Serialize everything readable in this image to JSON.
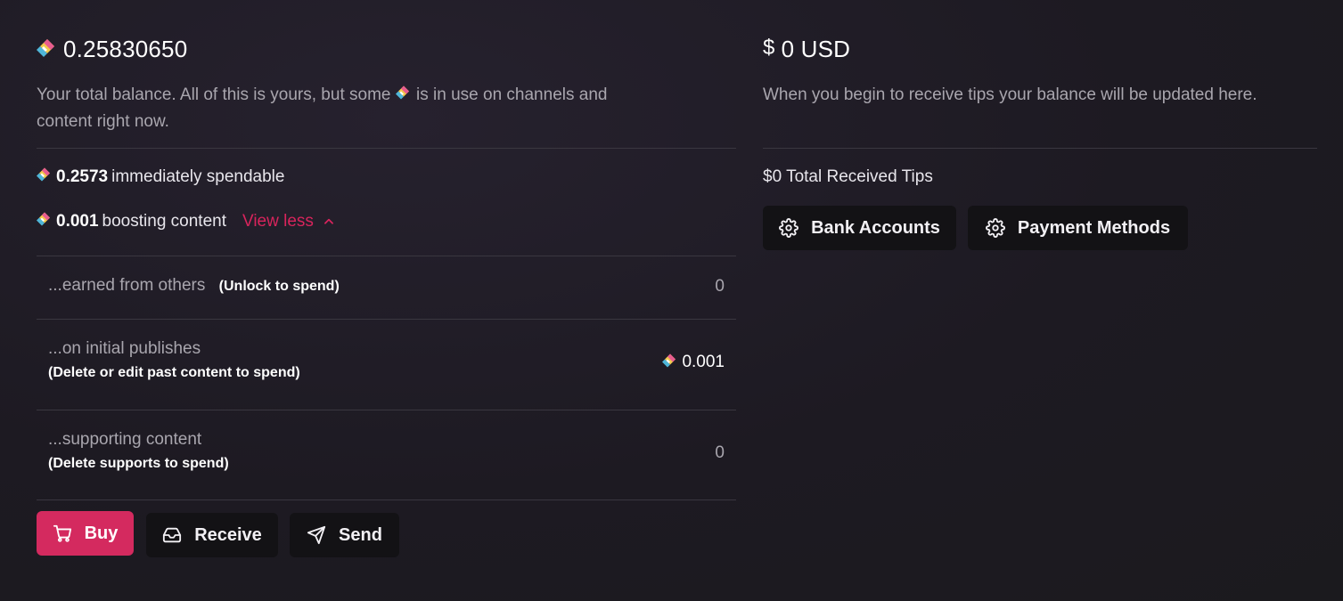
{
  "balance": {
    "amount": "0.25830650",
    "desc_part1": "Your total balance. All of this is yours, but some",
    "desc_part2": "is in use on channels and",
    "desc_part3": "content right now.",
    "spendable_amount": "0.2573",
    "spendable_label": "immediately spendable",
    "boosting_amount": "0.001",
    "boosting_label": "boosting content",
    "view_less_label": "View less"
  },
  "breakdown": [
    {
      "label": "...earned from others",
      "hint": "(Unlock to spend)",
      "value": "0"
    },
    {
      "label": "...on initial publishes",
      "hint": "(Delete or edit past content to spend)",
      "value": "0.001"
    },
    {
      "label": "...supporting content",
      "hint": "(Delete supports to spend)",
      "value": "0"
    }
  ],
  "actions": {
    "buy_label": "Buy",
    "receive_label": "Receive",
    "send_label": "Send"
  },
  "tips": {
    "amount": "0 USD",
    "desc": "When you begin to receive tips your balance will be updated here.",
    "total_received": "$0 Total Received Tips",
    "bank_accounts_label": "Bank Accounts",
    "payment_methods_label": "Payment Methods"
  },
  "icons": {
    "currency": "lbc-credits-icon",
    "usd": "dollar-sign-icon",
    "buy": "shopping-cart-icon",
    "receive": "inbox-icon",
    "send": "send-icon",
    "settings": "gear-icon",
    "view_less": "chevron-up-icon"
  },
  "colors": {
    "accent": "#d42a5f",
    "background": "#1d1a22",
    "button_dark": "#131215",
    "muted_text": "#a9a6ae"
  }
}
